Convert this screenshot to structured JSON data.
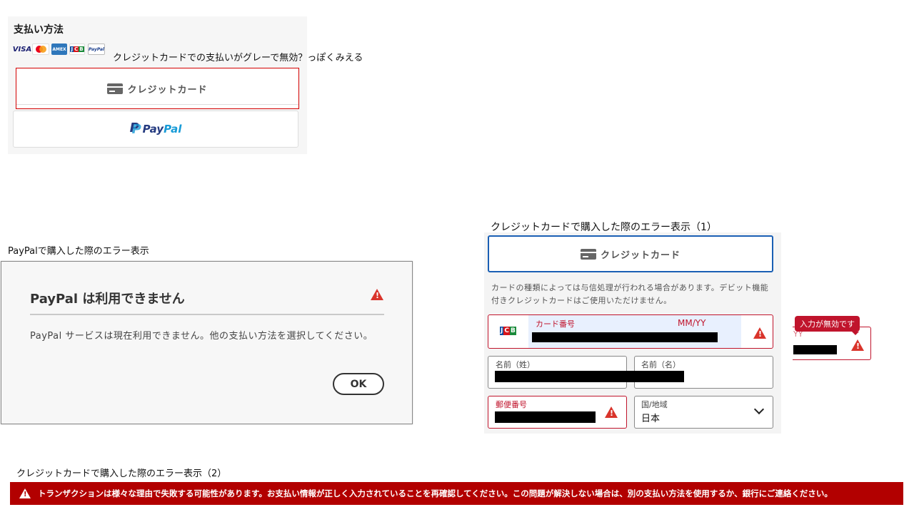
{
  "payment_panel": {
    "title": "支払い方法",
    "brands": [
      "VISA",
      "Mastercard",
      "AMEX",
      "JCB",
      "PayPal"
    ],
    "note": "クレジットカードでの支払いがグレーで無効？っぽくみえる",
    "credit_card_label": "クレジットカード",
    "paypal_pay": "Pay",
    "paypal_pal": "Pal"
  },
  "paypal_error": {
    "caption": "PayPalで購入した際のエラー表示",
    "dialog_title": "PayPal は利用できません",
    "dialog_message": "PayPal サービスは現在利用できません。他の支払い方法を選択してください。",
    "ok_label": "OK"
  },
  "card_error_1": {
    "caption": "クレジットカードで購入した際のエラー表示（1）",
    "credit_card_label": "クレジットカード",
    "note": "カードの種類によっては与信処理が行われる場合があります。デビット機能付きクレジットカードはご使用いただけません。",
    "card_number_label": "カード番号",
    "expiry_label": "MM/YY",
    "partial_expiry": "YY",
    "tooltip": "入力が無効です",
    "last_name_label": "名前（姓）",
    "first_name_label": "名前（名）",
    "postal_code_label": "郵便番号",
    "country_label": "国/地域",
    "country_value": "日本"
  },
  "card_error_2": {
    "caption": "クレジットカードで購入した際のエラー表示（2）",
    "banner_text": "トランザクションは様々な理由で失敗する可能性があります。お支払い情報が正しく入力されていることを再確認してください。この問題が解決しない場合は、別の支払い方法を使用するか、銀行にご連絡ください。"
  },
  "colors": {
    "error_red": "#c0142c",
    "banner_red": "#b20000",
    "focus_blue": "#1a5fb4",
    "paypal_dark": "#253b80",
    "paypal_light": "#179bd7"
  }
}
